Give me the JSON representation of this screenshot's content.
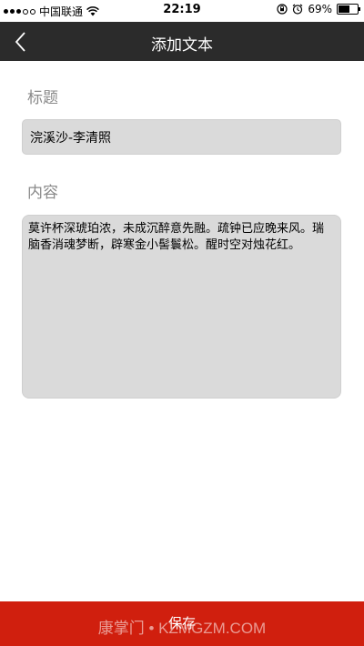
{
  "status_bar": {
    "carrier": "中国联通",
    "time": "22:19",
    "battery": "69%",
    "battery_level": 0.69,
    "icons": [
      "signal-dots-icon",
      "wifi-icon",
      "lock-rotation-icon",
      "alarm-icon",
      "battery-icon"
    ]
  },
  "nav": {
    "title": "添加文本",
    "back_icon": "chevron-left-icon"
  },
  "form": {
    "title_label": "标题",
    "title_value": "浣溪沙-李清照",
    "content_label": "内容",
    "content_value": "莫许杯深琥珀浓，未成沉醉意先融。疏钟已应晚来风。瑞脑香消魂梦断，辟寒金小髻鬟松。醒时空对烛花红。"
  },
  "footer": {
    "save_label": "保存",
    "watermark": "康掌门 • KZMGZM.COM"
  },
  "colors": {
    "nav_bg": "#2b2b2b",
    "save_bg": "#d01f0e",
    "field_bg": "#dadada",
    "label_color": "#8a8a8a"
  }
}
